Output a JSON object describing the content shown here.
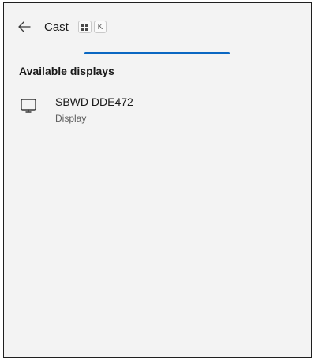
{
  "header": {
    "title": "Cast",
    "shortcut_keys": [
      "K"
    ]
  },
  "progress": {
    "indeterminate": true,
    "color": "#0a67c2"
  },
  "section": {
    "title": "Available displays"
  },
  "displays": [
    {
      "name": "SBWD DDE472",
      "type": "Display",
      "icon": "monitor-icon"
    }
  ]
}
